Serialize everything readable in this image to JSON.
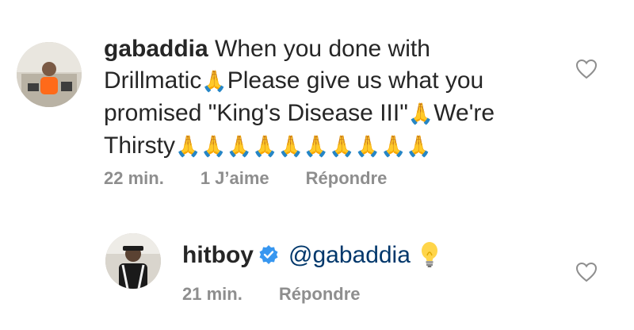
{
  "comments": [
    {
      "username": "gabaddia",
      "text_line1": "When you done with",
      "text_line2a": "Drillmatic",
      "emoji_pray": "🙏",
      "text_line2b": "Please give us what you",
      "text_line3a": "promised \"King's Disease III\"",
      "text_line3b": "We're",
      "text_line4a": "Thirsty",
      "pray_row": "🙏🙏🙏🙏🙏🙏🙏🙏🙏🙏",
      "time": "22 min.",
      "likes": "1 J’aime",
      "reply_label": "Répondre"
    },
    {
      "username": "hitboy",
      "mention": "@gabaddia",
      "time": "21 min.",
      "reply_label": "Répondre"
    }
  ],
  "icons": {
    "like": "heart-outline-icon",
    "verified": "verified-badge-icon",
    "bulb": "light-bulb-emoji"
  },
  "colors": {
    "text": "#262626",
    "muted": "#8e8e8e",
    "mention": "#00376b",
    "verified": "#3897f0"
  }
}
